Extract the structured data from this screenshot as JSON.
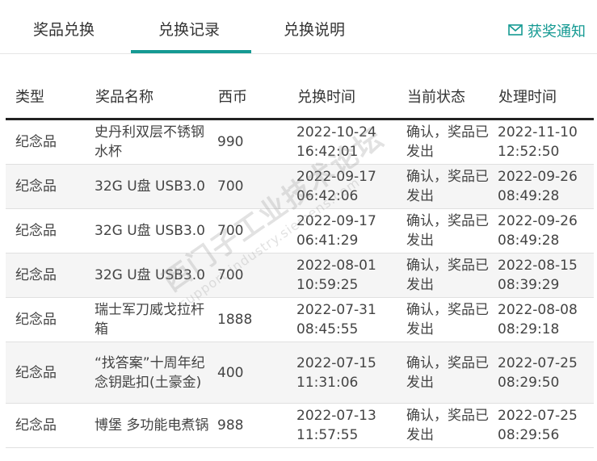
{
  "tabs": [
    {
      "label": "奖品兑换"
    },
    {
      "label": "兑换记录",
      "active": true
    },
    {
      "label": "兑换说明"
    }
  ],
  "notify": {
    "label": "获奖通知",
    "icon": "mail-icon"
  },
  "table": {
    "headers": [
      "类型",
      "奖品名称",
      "西币",
      "兑换时间",
      "当前状态",
      "处理时间"
    ],
    "rows": [
      {
        "type": "纪念品",
        "name": "史丹利双层不锈钢水杯",
        "coins": "990",
        "exchange_date": "2022-10-24",
        "exchange_time": "16:42:01",
        "status": "确认，奖品已发出",
        "process_date": "2022-11-10",
        "process_time": "12:52:50"
      },
      {
        "type": "纪念品",
        "name": "32G U盘 USB3.0",
        "coins": "700",
        "exchange_date": "2022-09-17",
        "exchange_time": "06:42:06",
        "status": "确认，奖品已发出",
        "process_date": "2022-09-26",
        "process_time": "08:49:28"
      },
      {
        "type": "纪念品",
        "name": "32G U盘 USB3.0",
        "coins": "700",
        "exchange_date": "2022-09-17",
        "exchange_time": "06:41:29",
        "status": "确认，奖品已发出",
        "process_date": "2022-09-26",
        "process_time": "08:49:28"
      },
      {
        "type": "纪念品",
        "name": "32G U盘 USB3.0",
        "coins": "700",
        "exchange_date": "2022-08-01",
        "exchange_time": "10:59:25",
        "status": "确认，奖品已发出",
        "process_date": "2022-08-15",
        "process_time": "08:39:29"
      },
      {
        "type": "纪念品",
        "name": "瑞士军刀威戈拉杆箱",
        "coins": "1888",
        "exchange_date": "2022-07-31",
        "exchange_time": "08:45:55",
        "status": "确认，奖品已发出",
        "process_date": "2022-08-08",
        "process_time": "08:29:18"
      },
      {
        "type": "纪念品",
        "name": "“找答案”十周年纪念钥匙扣(土豪金)",
        "coins": "400",
        "exchange_date": "2022-07-15",
        "exchange_time": "11:31:06",
        "status": "确认，奖品已发出",
        "process_date": "2022-07-25",
        "process_time": "08:29:50"
      },
      {
        "type": "纪念品",
        "name": "博堡 多功能电煮锅",
        "coins": "988",
        "exchange_date": "2022-07-13",
        "exchange_time": "11:57:55",
        "status": "确认，奖品已发出",
        "process_date": "2022-07-25",
        "process_time": "08:29:56"
      }
    ]
  },
  "watermark": {
    "line1": "西门子工业技术论坛",
    "line2": "support.industry.siemens.com"
  },
  "colors": {
    "accent": "#159a93",
    "header_border": "#222222",
    "row_alt": "#f5f5f5"
  }
}
